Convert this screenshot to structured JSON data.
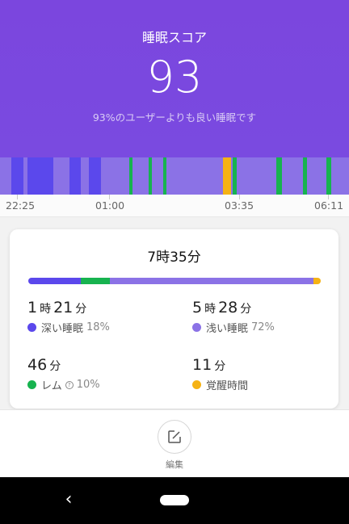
{
  "header": {
    "title": "睡眠スコア",
    "score": "93",
    "subtitle": "93%のユーザーよりも良い睡眠です"
  },
  "timeline": {
    "ticks": [
      "22:25",
      "01:00",
      "03:35",
      "06:11"
    ]
  },
  "summary": {
    "total": "7時35分",
    "deep": {
      "hours": "1",
      "hour_unit": "時",
      "minutes": "21",
      "minute_unit": "分",
      "label": "深い睡眠",
      "percent": "18%"
    },
    "light": {
      "hours": "5",
      "hour_unit": "時",
      "minutes": "28",
      "minute_unit": "分",
      "label": "浅い睡眠",
      "percent": "72%"
    },
    "rem": {
      "minutes": "46",
      "minute_unit": "分",
      "label": "レム",
      "percent": "10%"
    },
    "awake": {
      "minutes": "11",
      "minute_unit": "分",
      "label": "覚醒時間"
    }
  },
  "edit": {
    "label": "編集"
  },
  "colors": {
    "deep": "#5b48ec",
    "light": "#8b72e6",
    "rem": "#17b34f",
    "awake": "#f5b214",
    "header": "#7b46de"
  }
}
